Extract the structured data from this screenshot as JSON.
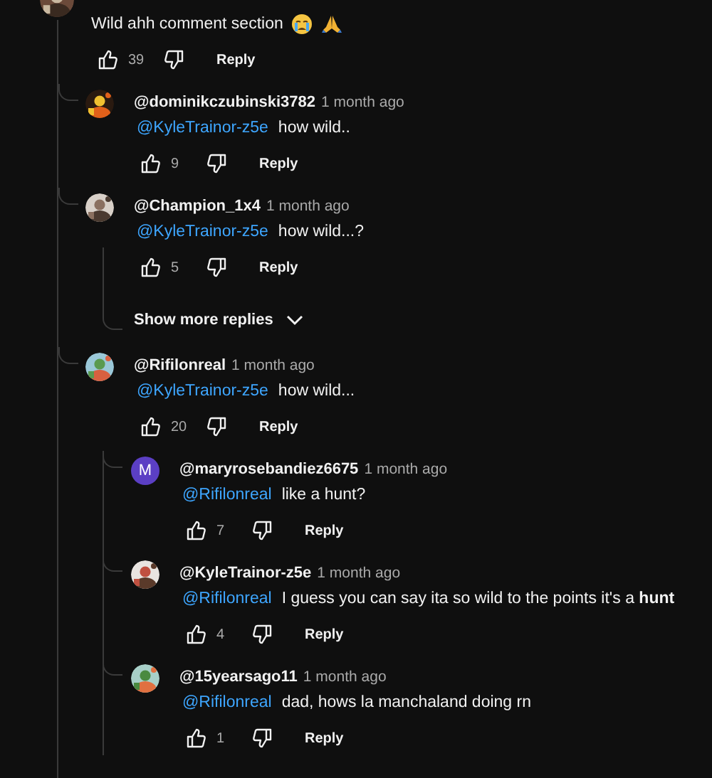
{
  "comment": {
    "text": "Wild ahh comment section",
    "likes": "39",
    "reply_label": "Reply",
    "replies": [
      {
        "kind": "comment",
        "author": "@dominikczubinski3782",
        "time": "1 month ago",
        "mention": "@KyleTrainor-z5e",
        "text": "how wild..",
        "likes": "9",
        "reply_label": "Reply",
        "avatar": {
          "kind": "picture"
        }
      },
      {
        "kind": "comment",
        "author": "@Champion_1x4",
        "time": "1 month ago",
        "mention": "@KyleTrainor-z5e",
        "text": "how wild...?",
        "likes": "5",
        "reply_label": "Reply",
        "avatar": {
          "kind": "picture"
        }
      },
      {
        "kind": "more",
        "label": "Show more replies"
      },
      {
        "kind": "comment",
        "author": "@Rifilonreal",
        "time": "1 month ago",
        "mention": "@KyleTrainor-z5e",
        "text": "how wild...",
        "likes": "20",
        "reply_label": "Reply",
        "avatar": {
          "kind": "picture"
        },
        "children": [
          {
            "kind": "comment",
            "author": "@maryrosebandiez6675",
            "time": "1 month ago",
            "mention": "@Rifilonreal",
            "text": "like a hunt?",
            "likes": "7",
            "reply_label": "Reply",
            "avatar": {
              "kind": "letter",
              "letter": "M",
              "color": "#5b3fc4"
            }
          },
          {
            "kind": "comment",
            "author": "@KyleTrainor-z5e",
            "time": "1 month ago",
            "mention": "@Rifilonreal",
            "text": "I guess you can say ita so wild to the points it's a **hunt**",
            "likes": "4",
            "reply_label": "Reply",
            "avatar": {
              "kind": "picture"
            }
          },
          {
            "kind": "comment",
            "author": "@15yearsago11",
            "time": "1 month ago",
            "mention": "@Rifilonreal",
            "text": "dad, hows la manchaland doing rn",
            "likes": "1",
            "reply_label": "Reply",
            "avatar": {
              "kind": "picture"
            }
          }
        ]
      }
    ]
  }
}
